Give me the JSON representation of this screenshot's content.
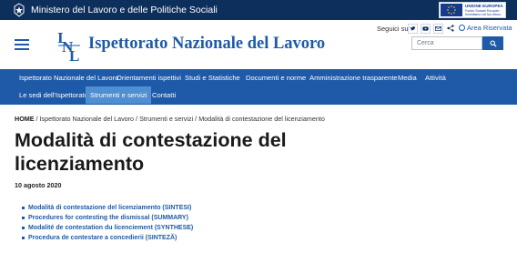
{
  "topbar": {
    "ministry": "Ministero del Lavoro e delle Politiche Sociali",
    "eu_logo": {
      "line1": "UNIONE EUROPEA",
      "line2": "Fondo Sociale Europeo",
      "line3": "Investiamo nel tuo futuro"
    }
  },
  "header": {
    "site_title": "Ispettorato Nazionale del Lavoro",
    "follow_label": "Seguici su:",
    "social_icons": [
      "twitter-icon",
      "youtube-icon",
      "email-icon",
      "share-icon"
    ],
    "reserved_area": "Area Riservata",
    "search_placeholder": "Cerca"
  },
  "nav": {
    "items": [
      {
        "label": "Ispettorato Nazionale del Lavoro"
      },
      {
        "label": "Orientamenti ispettivi"
      },
      {
        "label": "Studi e Statistiche"
      },
      {
        "label": "Documenti e norme"
      },
      {
        "label": "Amministrazione trasparente"
      },
      {
        "label": "Media"
      },
      {
        "label": "Attività"
      },
      {
        "label": "Le sedi dell'Ispettorato"
      },
      {
        "label": "Strumenti e servizi"
      },
      {
        "label": "Contatti"
      }
    ],
    "active": "Strumenti e servizi"
  },
  "breadcrumb": {
    "home": "HOME",
    "items": [
      "Ispettorato Nazionale del Lavoro",
      "Strumenti e servizi",
      "Modalità di contestazione del licenziamento"
    ],
    "separator": " / "
  },
  "main": {
    "title": "Modalità di contestazione del licenziamento",
    "date": "10 agosto 2020",
    "links": [
      "Modalità di contestazione del licenziamento (SINTESI)",
      "Procedures for contesting the dismissal (SUMMARY)",
      "Modalité de contestation du licenciement (SYNTHESE)",
      "Procedura de contestare a concedierii (SINTEZĂ)"
    ]
  },
  "colors": {
    "topbar": "#0d2f5c",
    "brand_blue": "#1e5aa8",
    "nav_active": "#4f8ed0"
  }
}
